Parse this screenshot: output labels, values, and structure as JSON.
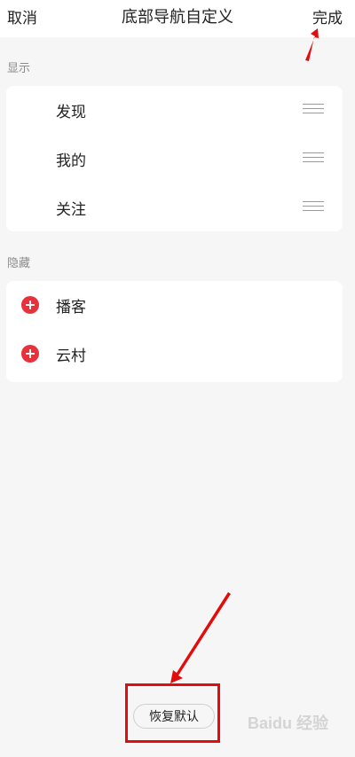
{
  "header": {
    "cancel_label": "取消",
    "title": "底部导航自定义",
    "done_label": "完成"
  },
  "sections": {
    "shown_label": "显示",
    "shown_items": [
      {
        "label": "发现"
      },
      {
        "label": "我的"
      },
      {
        "label": "关注"
      }
    ],
    "hidden_label": "隐藏",
    "hidden_items": [
      {
        "label": "播客"
      },
      {
        "label": "云村"
      }
    ]
  },
  "footer": {
    "restore_label": "恢复默认"
  },
  "watermark": "Baidu 经验",
  "colors": {
    "accent": "#e8313a",
    "annotation": "#e30b0b",
    "background": "#f6f6f7"
  }
}
